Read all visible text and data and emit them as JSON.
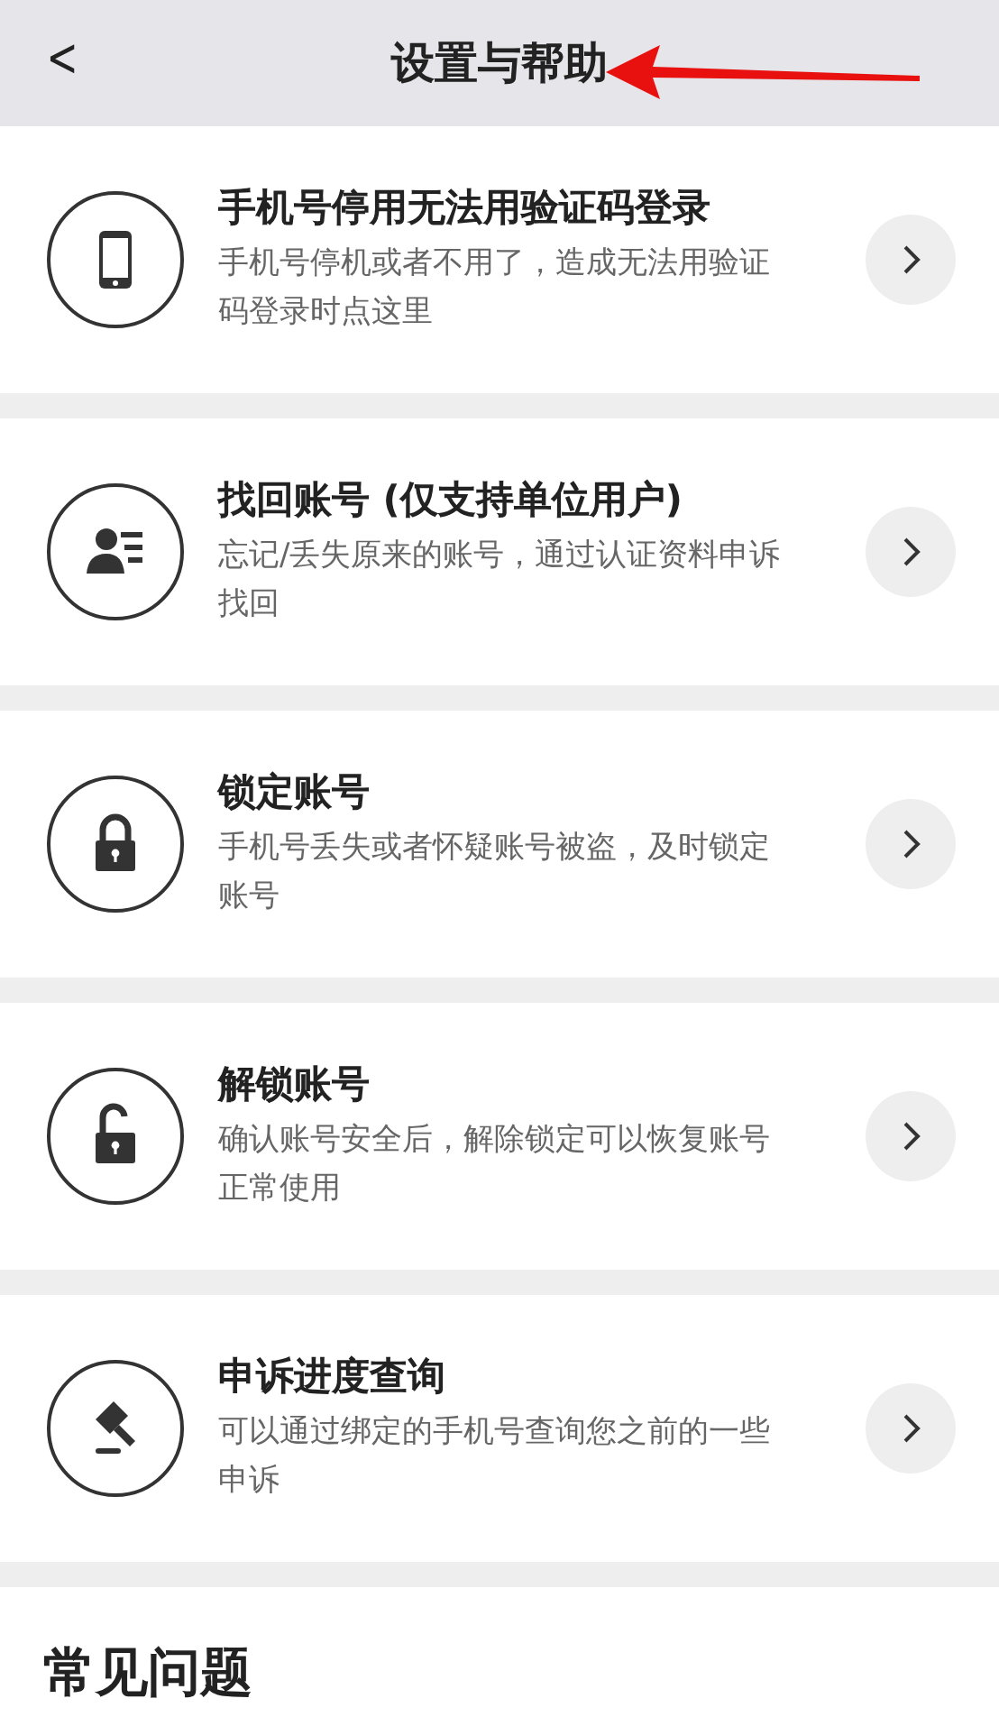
{
  "header": {
    "back": "<",
    "title": "设置与帮助"
  },
  "items": [
    {
      "kind": "phone",
      "title": "手机号停用无法用验证码登录",
      "description": "手机号停机或者不用了，造成无法用验证码登录时点这里"
    },
    {
      "kind": "account",
      "title": "找回账号 (仅支持单位用户)",
      "description": "忘记/丢失原来的账号，通过认证资料申诉找回"
    },
    {
      "kind": "lock",
      "title": "锁定账号",
      "description": "手机号丢失或者怀疑账号被盗，及时锁定账号"
    },
    {
      "kind": "unlock",
      "title": "解锁账号",
      "description": "确认账号安全后，解除锁定可以恢复账号正常使用"
    },
    {
      "kind": "gavel",
      "title": "申诉进度查询",
      "description": "可以通过绑定的手机号查询您之前的一些申诉"
    }
  ],
  "faq": {
    "heading": "常见问题"
  }
}
